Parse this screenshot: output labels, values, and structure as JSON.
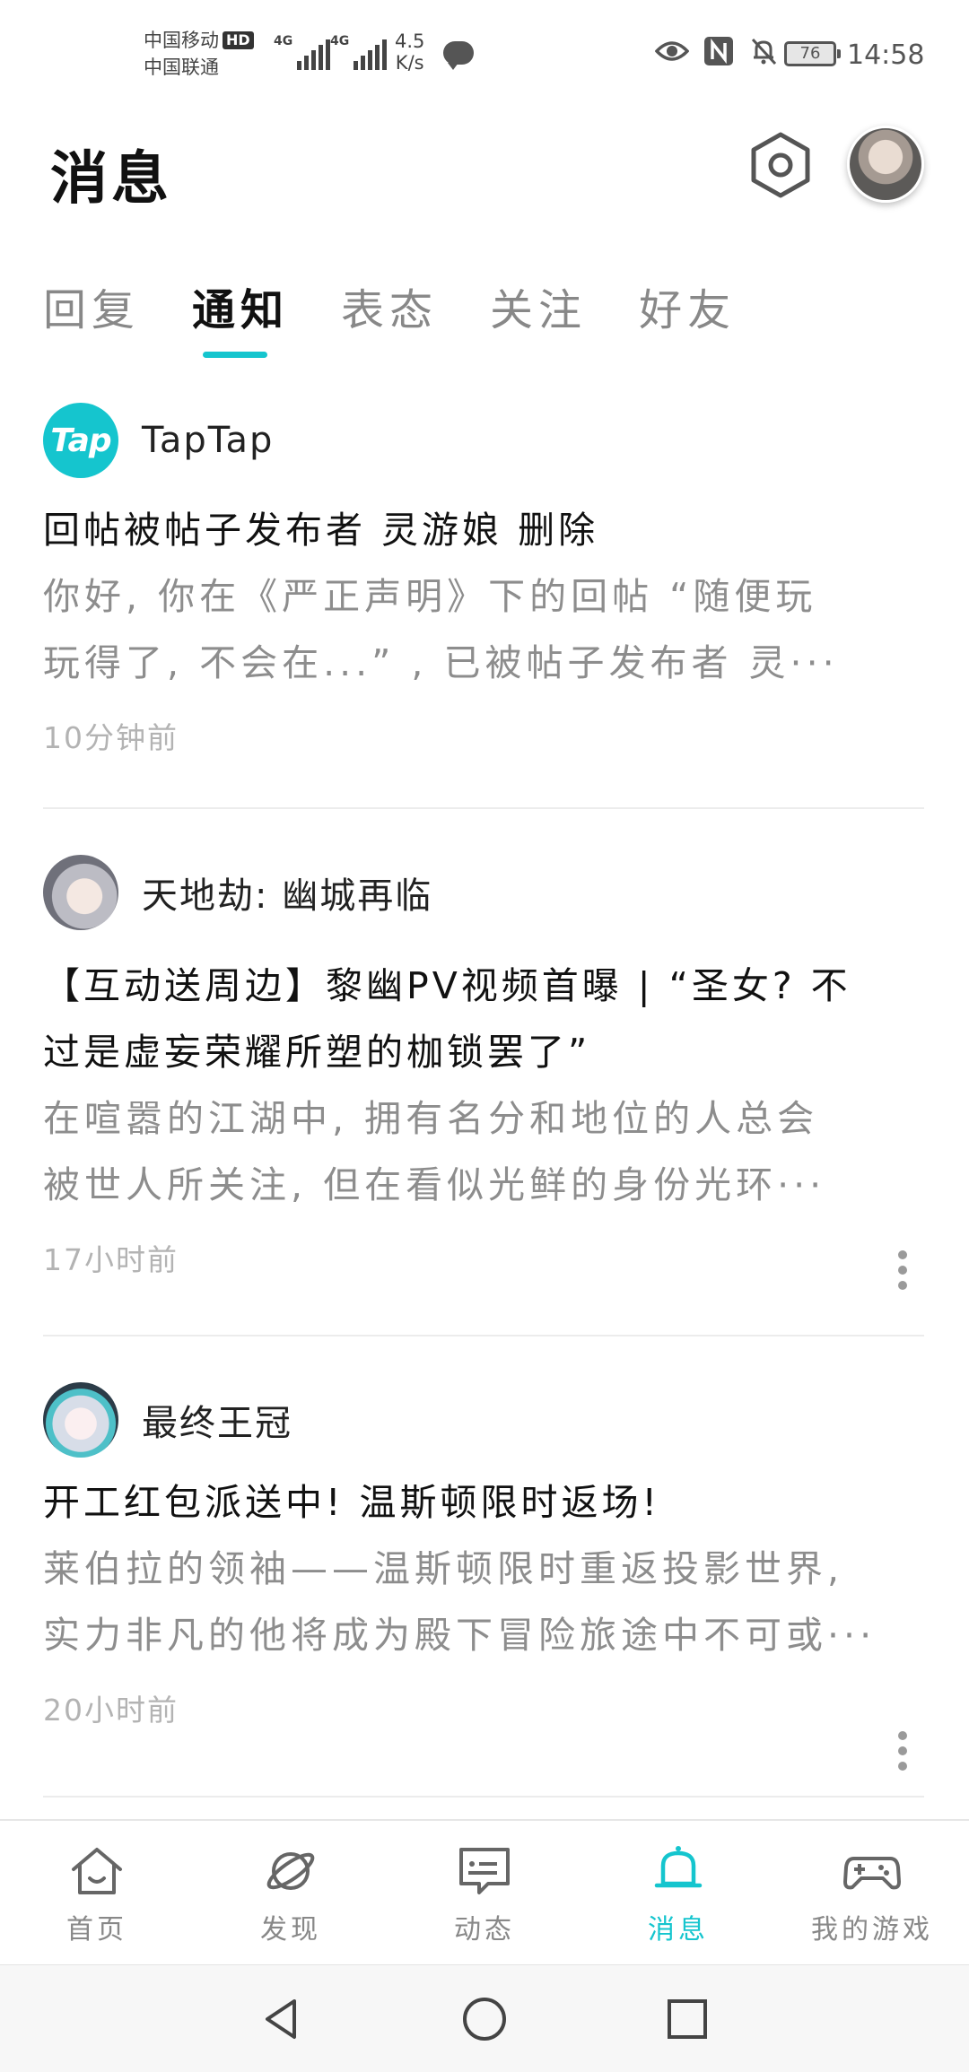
{
  "status_bar": {
    "carrier_1": "中国移动",
    "hd_badge": "HD",
    "carrier_2": "中国联通",
    "network_1": "4G",
    "network_2": "4G",
    "net_speed_value": "4.5",
    "net_speed_unit": "K/s",
    "battery_level": "76",
    "time": "14:58"
  },
  "header": {
    "title": "消息"
  },
  "tabs": [
    {
      "label": "回复",
      "active": false
    },
    {
      "label": "通知",
      "active": true
    },
    {
      "label": "表态",
      "active": false
    },
    {
      "label": "关注",
      "active": false
    },
    {
      "label": "好友",
      "active": false
    }
  ],
  "notifications": [
    {
      "avatar_text": "Tap",
      "source": "TapTap",
      "title": "回帖被帖子发布者 灵游娘 删除",
      "body_line_1": "你好, 你在《严正声明》下的回帖 “随便玩",
      "body_line_2": "玩得了, 不会在...” , 已被帖子发布者 灵···",
      "time": "10分钟前"
    },
    {
      "source": "天地劫: 幽城再临",
      "title_line_1": "【互动送周边】黎幽PV视频首曝 | “圣女? 不",
      "title_line_2": "过是虚妄荣耀所塑的枷锁罢了”",
      "body_line_1": "在喧嚣的江湖中, 拥有名分和地位的人总会",
      "body_line_2": "被世人所关注, 但在看似光鲜的身份光环···",
      "time": "17小时前"
    },
    {
      "source": "最终王冠",
      "title": "开工红包派送中! 温斯顿限时返场!",
      "body_line_1": "莱伯拉的领袖——温斯顿限时重返投影世界,",
      "body_line_2": "实力非凡的他将成为殿下冒险旅途中不可或···",
      "time": "20小时前"
    }
  ],
  "bottom_nav": [
    {
      "label": "首页",
      "icon": "home-icon"
    },
    {
      "label": "发现",
      "icon": "planet-icon"
    },
    {
      "label": "动态",
      "icon": "chat-icon"
    },
    {
      "label": "消息",
      "icon": "bell-icon",
      "active": true
    },
    {
      "label": "我的游戏",
      "icon": "gamepad-icon"
    }
  ],
  "colors": {
    "accent": "#15c5ce",
    "text_primary": "#111111",
    "text_secondary": "#8d8d8d",
    "text_muted": "#b3b3b3"
  }
}
